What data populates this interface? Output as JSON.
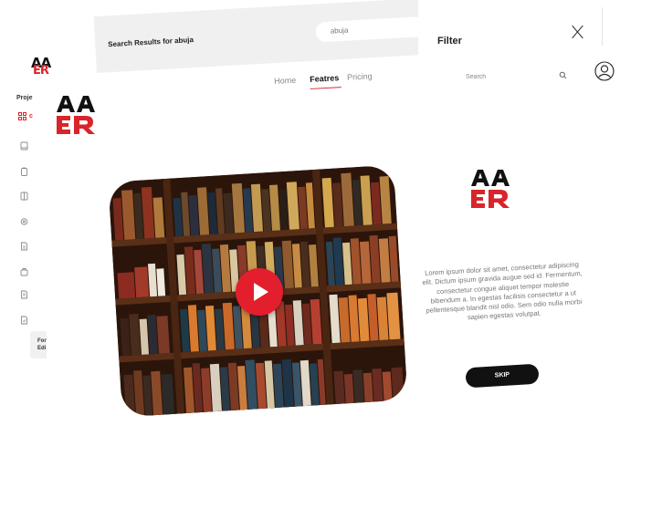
{
  "brand": {
    "logo_top": "AA",
    "logo_bottom": "ER",
    "accent_color": "#d8252b",
    "dark_color": "#111111"
  },
  "sidebar": {
    "project_label": "Proje",
    "grid_label": "c",
    "icons": [
      "book-icon",
      "clipboard-icon",
      "columns-icon",
      "settings-icon",
      "document-icon",
      "briefcase-icon",
      "file-icon",
      "file-check-icon"
    ],
    "card_line1": "For",
    "card_line2": "Edi"
  },
  "search_header": {
    "title": "Search Results for abuja",
    "query": "abuja"
  },
  "nav": {
    "items": [
      "Home",
      "Featres",
      "Pricing"
    ],
    "active": "Featres"
  },
  "video": {
    "thumbnail": "bookshelf",
    "play_icon": "play-icon",
    "play_color": "#e31e2d"
  },
  "filter": {
    "title": "Filter",
    "close_label": "X",
    "search_placeholder": "Search",
    "search_icon": "search-icon",
    "user_icon": "user-icon"
  },
  "onboarding": {
    "description": "Lorem ipsum dolor sit amet, consectetur adipiscing elit. Dictum ipsum gravida augue sed id. Fermentum, consectetur congue aliquet tempor molestie bibendum a. In egestas facilisis consectetur a ut pellentesque blandit nisl odio. Sem odio nulla morbi sapien egestas volutpat.",
    "skip_label": "SKIP"
  }
}
